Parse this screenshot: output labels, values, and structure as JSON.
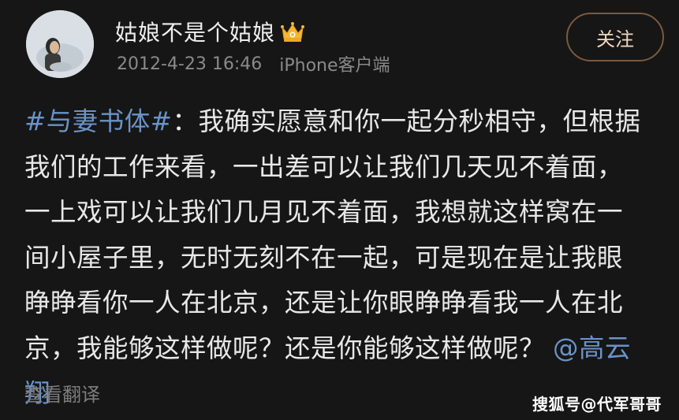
{
  "post": {
    "username": "姑娘不是个姑娘",
    "date": "2012-4-23 16:46",
    "source": "iPhone客户端",
    "follow_label": "关注",
    "lines": [
      {
        "tag": "#与妻书体#",
        "text": "：我确实愿意和你一起分秒相守，但根据"
      },
      {
        "text": "我们的工作来看，一出差可以让我们几天见不着面，"
      },
      {
        "text": "一上戏可以让我们几月见不着面，我想就这样窝在一"
      },
      {
        "text": "间小屋子里，无时无刻不在一起，可是现在是让我眼"
      },
      {
        "text": "睁睁看你一人在北京，还是让你眼睁睁看我一人在北"
      },
      {
        "text": "京，我能够这样做呢？还是你能够这样做呢？",
        "mention": "@高云"
      },
      {
        "mention": "翔"
      }
    ],
    "translate_label": "查看翻译"
  },
  "watermark": "搜狐号@代军哥哥",
  "icons": {
    "crown": "crown-icon",
    "avatar": "avatar-image"
  },
  "colors": {
    "background": "#161616",
    "link": "#6a93c7",
    "follow_text": "#f3d7bd",
    "follow_border": "#7a5a3e",
    "crown": "#f5b731"
  }
}
